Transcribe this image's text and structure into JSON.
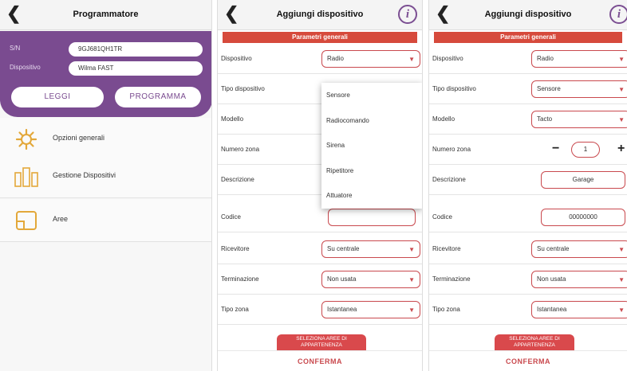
{
  "screen1": {
    "title": "Programmatore",
    "sn_label": "S/N",
    "sn_value": "9GJ681QH1TR",
    "device_label": "Dispositivo",
    "device_value": "Wilma FAST",
    "read_button": "LEGGI",
    "program_button": "PROGRAMMA",
    "menu": [
      {
        "label": "Opzioni generali",
        "icon": "gear-icon"
      },
      {
        "label": "Gestione Dispositivi",
        "icon": "devices-icon"
      },
      {
        "label": "Aree",
        "icon": "area-icon"
      }
    ]
  },
  "screen2": {
    "title": "Aggiungi dispositivo",
    "section": "Parametri generali",
    "fields": {
      "dispositivo": {
        "label": "Dispositivo",
        "value": "Radio"
      },
      "tipo": {
        "label": "Tipo dispositivo"
      },
      "modello": {
        "label": "Modello"
      },
      "zona": {
        "label": "Numero zona"
      },
      "descrizione": {
        "label": "Descrizione"
      },
      "codice": {
        "label": "Codice",
        "value": ""
      },
      "ricevitore": {
        "label": "Ricevitore",
        "value": "Su centrale"
      },
      "terminazione": {
        "label": "Terminazione",
        "value": "Non usata"
      },
      "tipo_zona": {
        "label": "Tipo zona",
        "value": "Istantanea"
      }
    },
    "dropdown_options": [
      "Sensore",
      "Radiocomando",
      "Sirena",
      "Ripetitore",
      "Attuatore"
    ],
    "areas_button": "SELEZIONA AREE DI APPARTENENZA",
    "confirm": "CONFERMA"
  },
  "screen3": {
    "title": "Aggiungi dispositivo",
    "section": "Parametri generali",
    "fields": {
      "dispositivo": {
        "label": "Dispositivo",
        "value": "Radio"
      },
      "tipo": {
        "label": "Tipo dispositivo",
        "value": "Sensore"
      },
      "modello": {
        "label": "Modello",
        "value": "Tacto"
      },
      "zona": {
        "label": "Numero zona",
        "value": "1"
      },
      "descrizione": {
        "label": "Descrizione",
        "value": "Garage"
      },
      "codice": {
        "label": "Codice",
        "value": "00000000"
      },
      "ricevitore": {
        "label": "Ricevitore",
        "value": "Su centrale"
      },
      "terminazione": {
        "label": "Terminazione",
        "value": "Non usata"
      },
      "tipo_zona": {
        "label": "Tipo zona",
        "value": "Istantanea"
      }
    },
    "areas_button": "SELEZIONA AREE DI APPARTENENZA",
    "confirm": "CONFERMA"
  },
  "colors": {
    "purple": "#7a4b90",
    "accent_red": "#c9494e",
    "section_red": "#d64a3c"
  }
}
